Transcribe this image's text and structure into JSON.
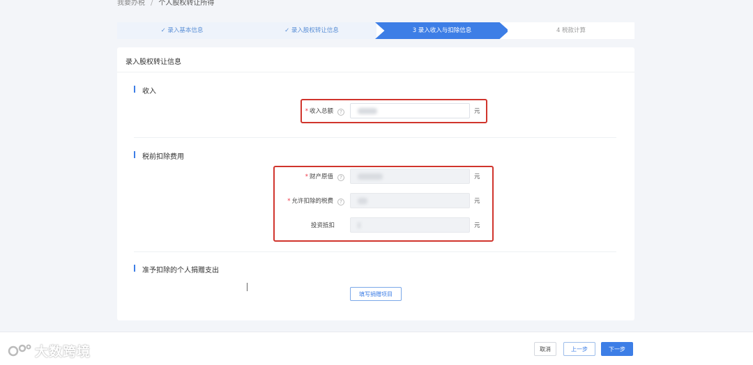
{
  "breadcrumb": {
    "parent": "我要办税",
    "separator": "/",
    "current": "个人股权转让所得"
  },
  "steps": [
    {
      "label": "✓ 录入基本信息",
      "state": "done"
    },
    {
      "label": "✓ 录入股权转让信息",
      "state": "done"
    },
    {
      "label": "3  录入收入与扣除信息",
      "state": "active"
    },
    {
      "label": "4  税款计算",
      "state": "todo"
    }
  ],
  "card": {
    "title": "录入股权转让信息",
    "sections": {
      "income": {
        "title": "收入",
        "fields": {
          "total_income": {
            "label": "收入总额",
            "required": "*",
            "unit": "元",
            "help": "?"
          }
        }
      },
      "pre_tax_deduction": {
        "title": "税前扣除费用",
        "fields": {
          "original_value": {
            "label": "财产原值",
            "required": "*",
            "unit": "元",
            "help": "?"
          },
          "deductible_tax": {
            "label": "允许扣除的税费",
            "required": "*",
            "unit": "元",
            "help": "?"
          },
          "investment_offset": {
            "label": "投资抵扣",
            "unit": "元"
          }
        }
      },
      "donation": {
        "title": "准予扣除的个人捐赠支出",
        "button": "填写捐赠项目"
      }
    }
  },
  "footer": {
    "cancel": "取消",
    "prev": "上一步",
    "next": "下一步"
  },
  "watermark": "大数跨境",
  "colors": {
    "accent": "#3d7ee6",
    "highlight_box": "#d0342c",
    "required_star": "#e34"
  }
}
